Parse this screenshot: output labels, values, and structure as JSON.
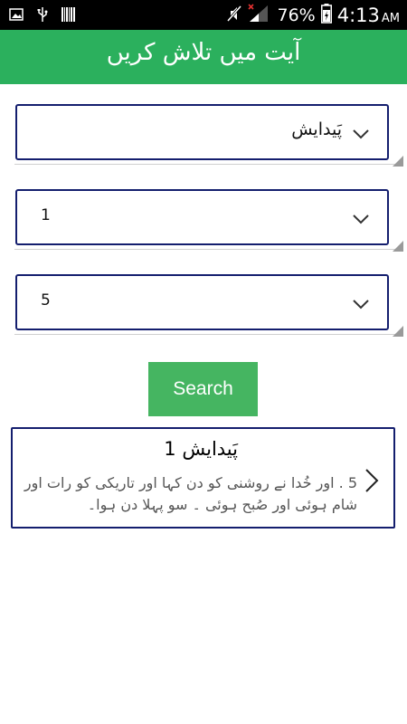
{
  "status_bar": {
    "battery_percent": "76%",
    "time": "4:13",
    "ampm": "AM"
  },
  "app_bar": {
    "title": "آیت میں تلاش کریں"
  },
  "selectors": {
    "book": "پَیدایش",
    "chapter": "1",
    "verse": "5"
  },
  "search_button": {
    "label": "Search"
  },
  "result": {
    "title": "پَیدایش 1",
    "text": "5 . اور خُدا نے روشنی کو دن کہا اور تاریکی کو رات اور شام ہوئی اور صُبح ہوئی ۔ سو پہلا دن ہوا۔"
  },
  "icons": {
    "status_left": [
      "image-icon",
      "usb-icon",
      "barcode-icon"
    ],
    "status_right": [
      "mute-icon",
      "signal-icon",
      "battery-icon"
    ],
    "dropdown": "chevron-down-icon",
    "result": "chevron-right-icon"
  }
}
